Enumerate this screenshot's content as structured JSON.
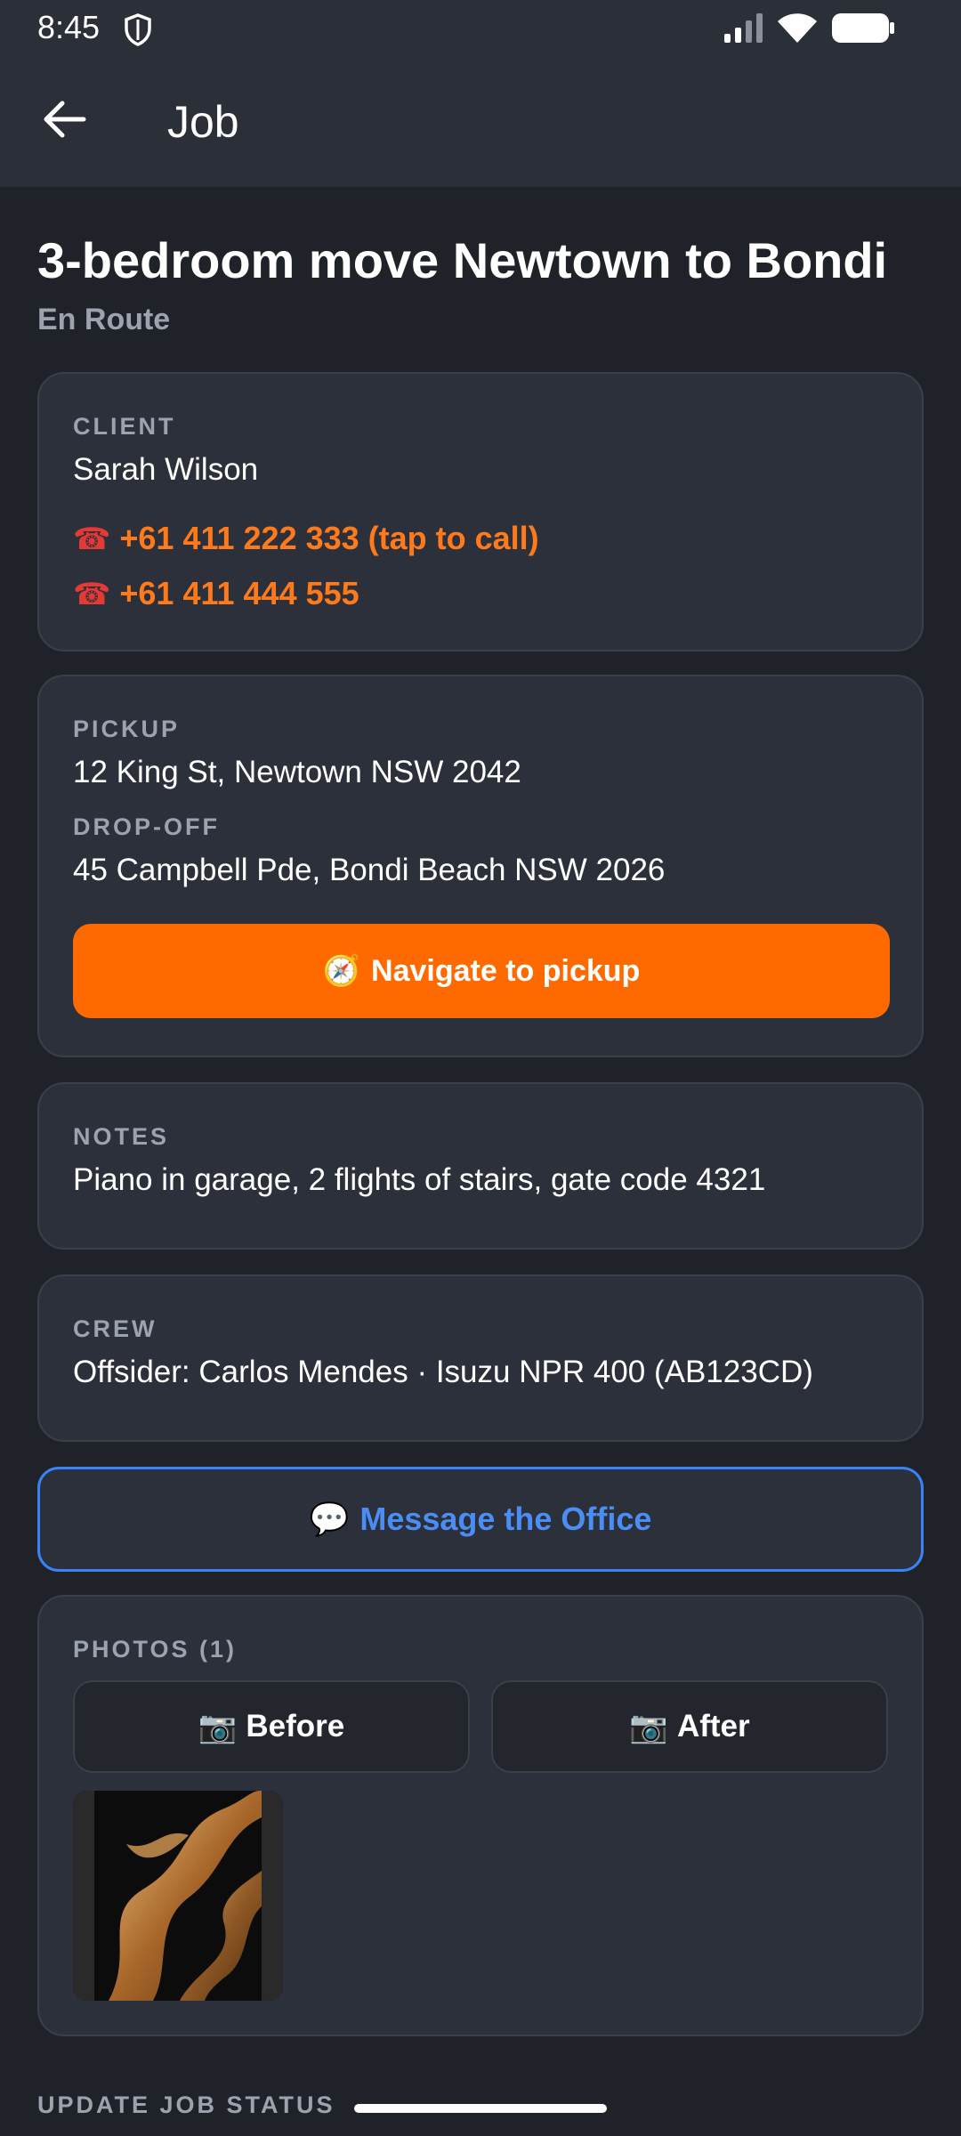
{
  "status_bar": {
    "time": "8:45"
  },
  "app_bar": {
    "title": "Job"
  },
  "job": {
    "title": "3-bedroom move Newtown to Bondi",
    "status": "En Route"
  },
  "client": {
    "label": "CLIENT",
    "name": "Sarah Wilson",
    "phone_icon": "☎",
    "phones": [
      "+61 411 222 333 (tap to call)",
      "+61 411 444 555"
    ]
  },
  "addresses": {
    "pickup_label": "PICKUP",
    "pickup": "12 King St, Newtown NSW 2042",
    "dropoff_label": "DROP-OFF",
    "dropoff": "45 Campbell Pde, Bondi Beach NSW 2026",
    "navigate_icon": "🧭",
    "navigate_label": "Navigate to pickup"
  },
  "notes": {
    "label": "NOTES",
    "text": "Piano in garage, 2 flights of stairs, gate code 4321"
  },
  "crew": {
    "label": "CREW",
    "text": "Offsider: Carlos Mendes · Isuzu NPR 400 (AB123CD)"
  },
  "message": {
    "icon": "💬",
    "label": "Message the Office"
  },
  "photos": {
    "label": "PHOTOS (1)",
    "camera_icon": "📷",
    "before_label": "Before",
    "after_label": "After"
  },
  "update_status": {
    "label": "UPDATE JOB STATUS"
  },
  "colors": {
    "accent": "#ff6a00",
    "link_blue": "#3b82f6",
    "background": "#1f2228",
    "card": "#2c303a"
  }
}
